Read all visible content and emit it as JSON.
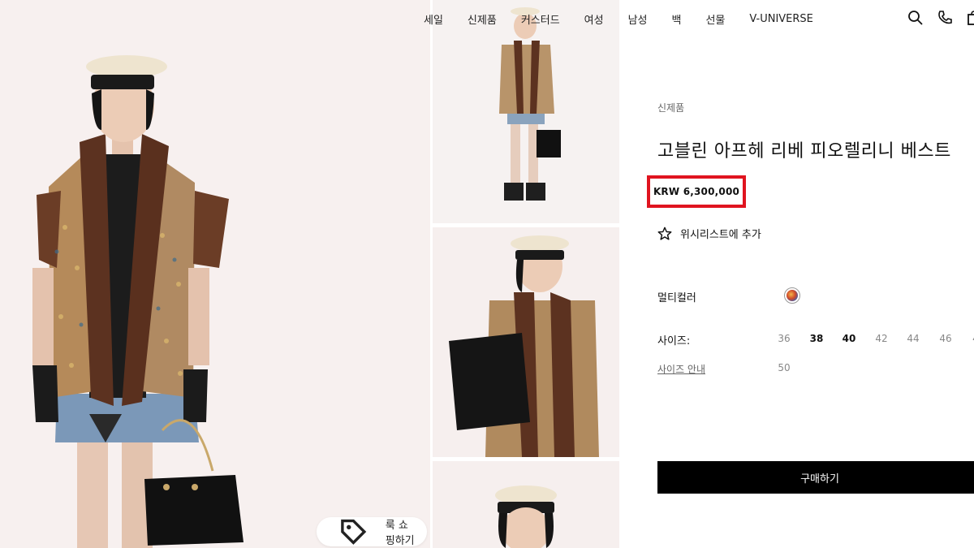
{
  "nav": {
    "items": [
      "세일",
      "신제품",
      "커스터드",
      "여성",
      "남성",
      "백",
      "선물",
      "V-UNIVERSE"
    ],
    "icons": [
      "search-icon",
      "phone-icon",
      "bag-icon"
    ]
  },
  "hero": {
    "shop_look_label": "룩 쇼핑하기",
    "icon": "tag-icon"
  },
  "product": {
    "breadcrumb": "신제품",
    "title": "고블린 아프헤 리베 피오렐리니 베스트",
    "price": "KRW 6,300,000",
    "wishlist_label": "위시리스트에 추가",
    "color_label": "멀티컬러",
    "size_label": "사이즈:",
    "size_guide_label": "사이즈 안내",
    "sizes": [
      {
        "label": "36",
        "available": false
      },
      {
        "label": "38",
        "available": true
      },
      {
        "label": "40",
        "available": true
      },
      {
        "label": "42",
        "available": false
      },
      {
        "label": "44",
        "available": false
      },
      {
        "label": "46",
        "available": false
      },
      {
        "label": "4",
        "available": false
      },
      {
        "label": "50",
        "available": false
      }
    ],
    "buy_label": "구매하기"
  },
  "colors": {
    "highlight_border": "#e0141f",
    "buy_button_bg": "#000000",
    "hero_bg": "#f7f0ef"
  }
}
